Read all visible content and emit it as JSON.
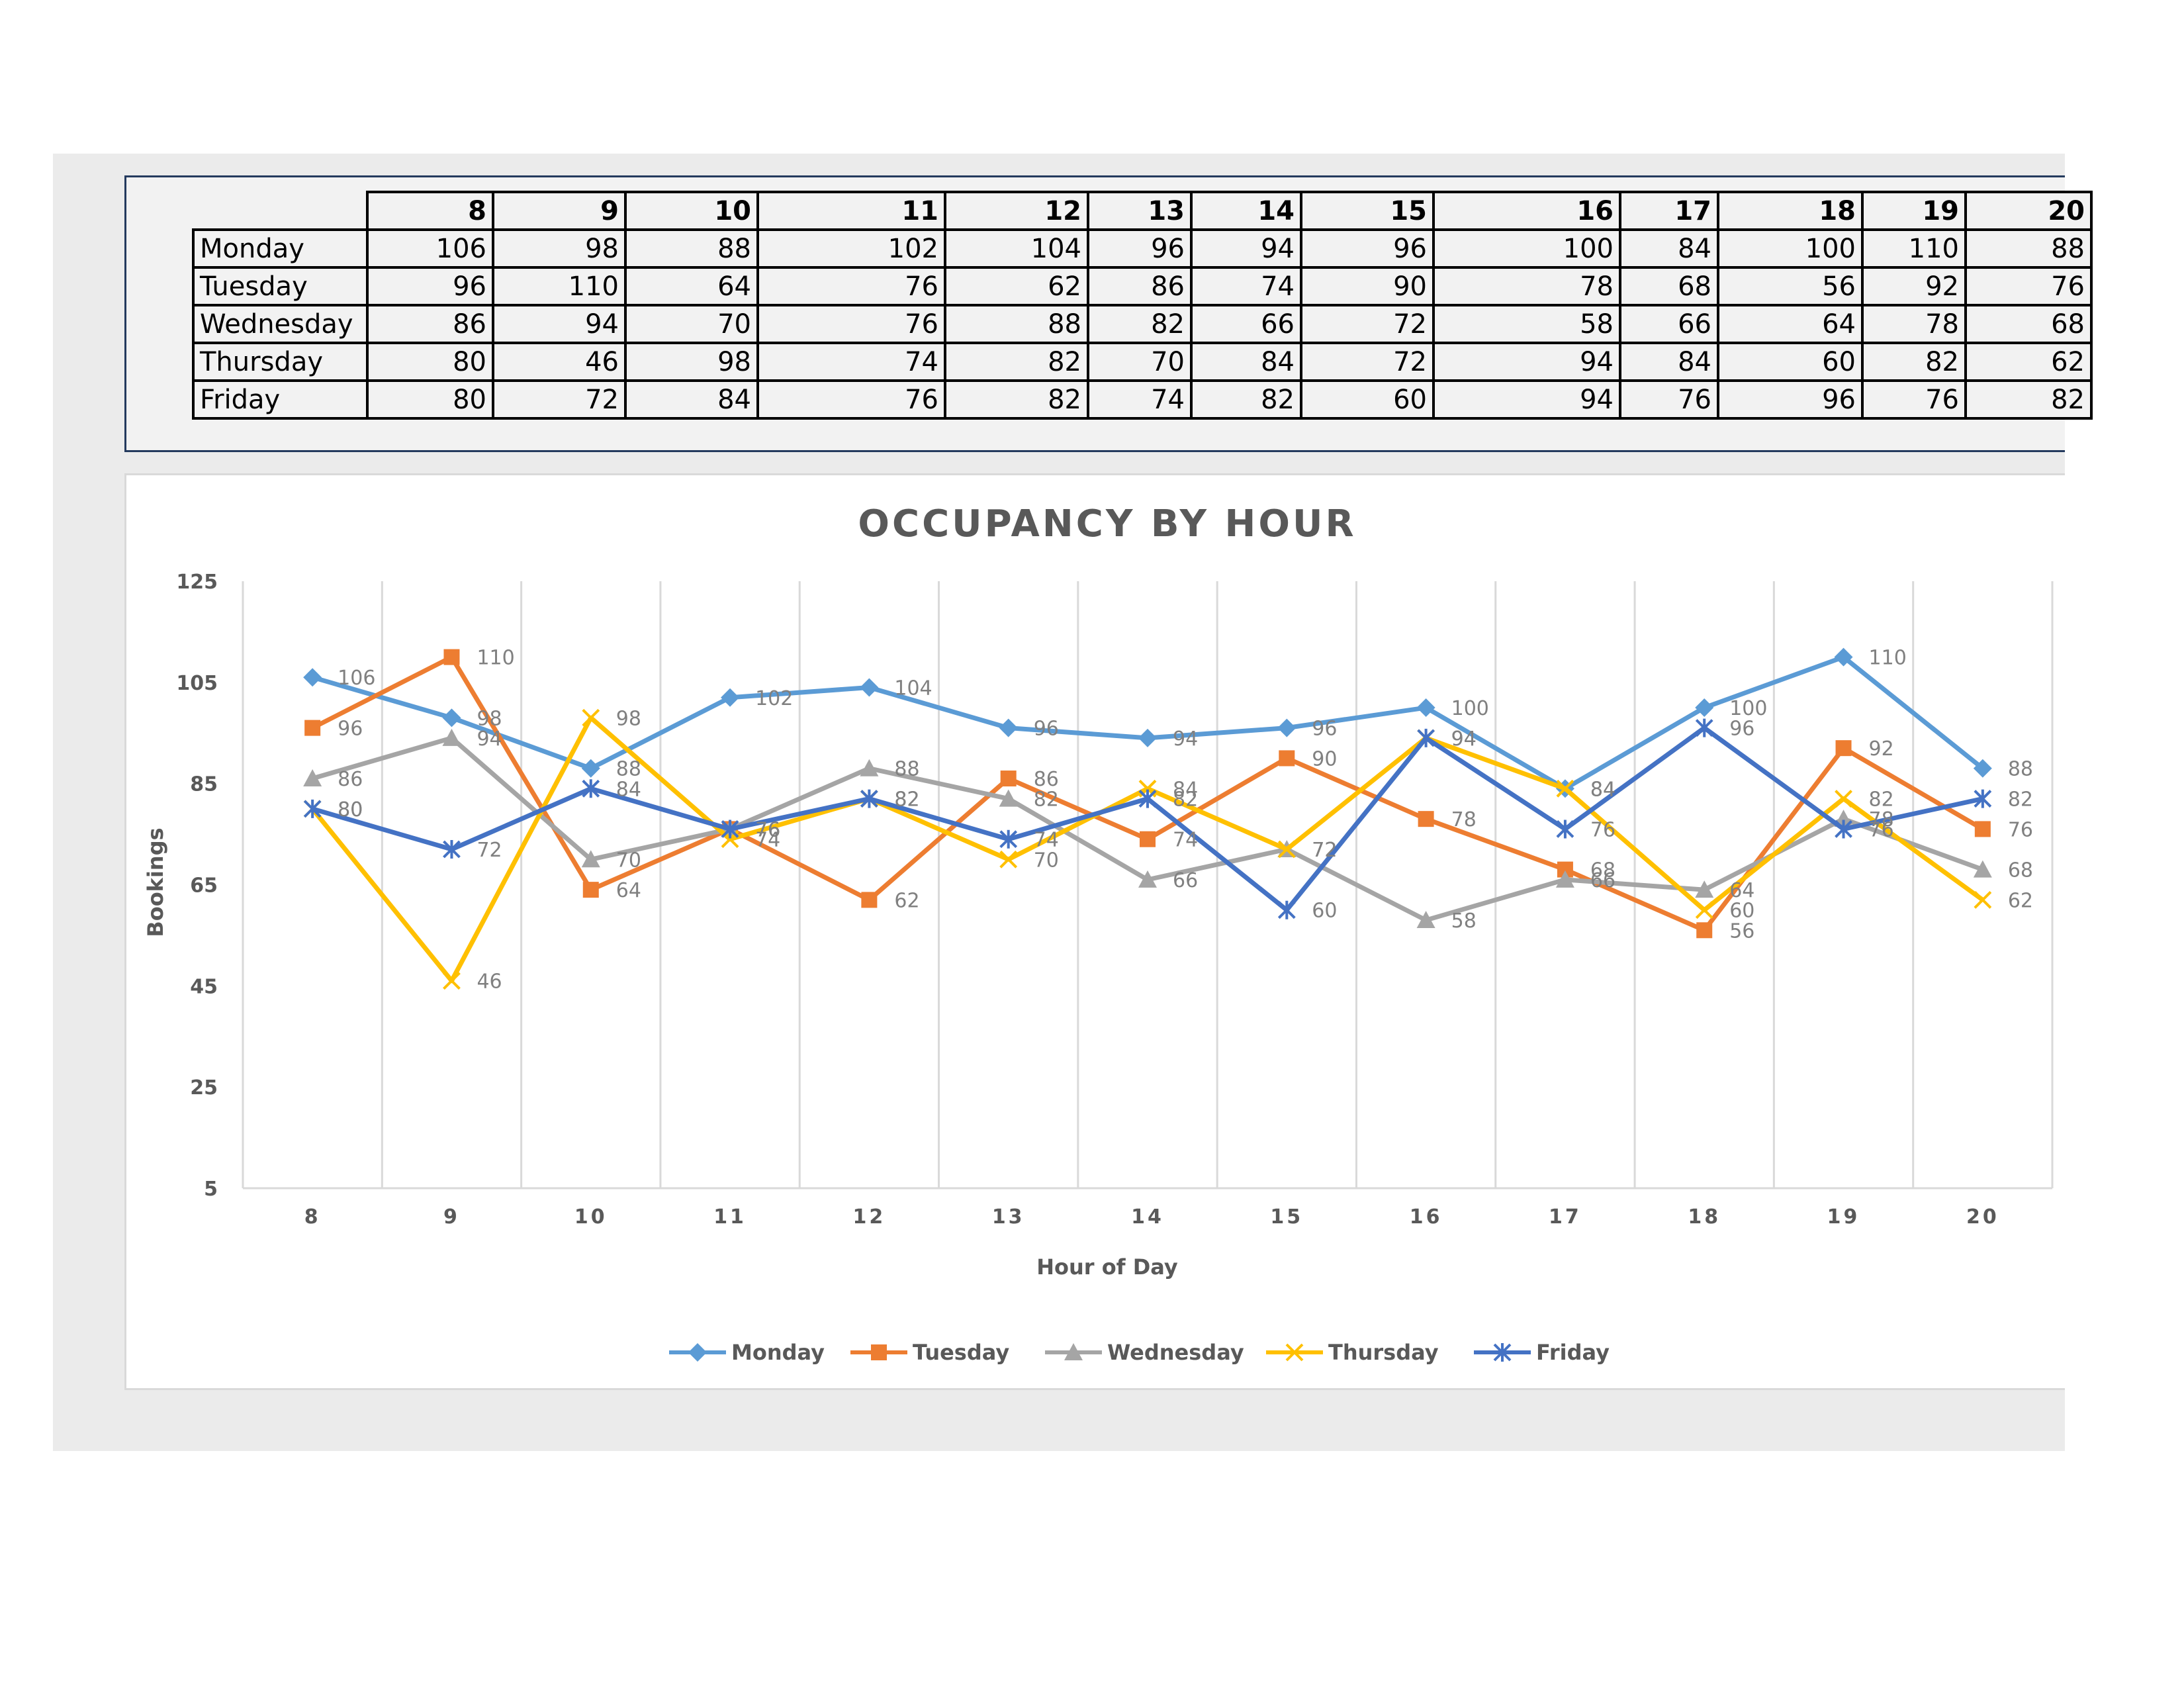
{
  "table": {
    "hours": [
      "8",
      "9",
      "10",
      "11",
      "12",
      "13",
      "14",
      "15",
      "16",
      "17",
      "18",
      "19",
      "20"
    ],
    "rows": [
      {
        "day": "Monday",
        "values": [
          "106",
          "98",
          "88",
          "102",
          "104",
          "96",
          "94",
          "96",
          "100",
          "84",
          "100",
          "110",
          "88"
        ]
      },
      {
        "day": "Tuesday",
        "values": [
          "96",
          "110",
          "64",
          "76",
          "62",
          "86",
          "74",
          "90",
          "78",
          "68",
          "56",
          "92",
          "76"
        ]
      },
      {
        "day": "Wednesday",
        "values": [
          "86",
          "94",
          "70",
          "76",
          "88",
          "82",
          "66",
          "72",
          "58",
          "66",
          "64",
          "78",
          "68"
        ]
      },
      {
        "day": "Thursday",
        "values": [
          "80",
          "46",
          "98",
          "74",
          "82",
          "70",
          "84",
          "72",
          "94",
          "84",
          "60",
          "82",
          "62"
        ]
      },
      {
        "day": "Friday",
        "values": [
          "80",
          "72",
          "84",
          "76",
          "82",
          "74",
          "82",
          "60",
          "94",
          "76",
          "96",
          "76",
          "82"
        ]
      }
    ]
  },
  "chart_data": {
    "type": "line",
    "title": "OCCUPANCY BY HOUR",
    "xlabel": "Hour of Day",
    "ylabel": "Bookings",
    "categories": [
      "8",
      "9",
      "10",
      "11",
      "12",
      "13",
      "14",
      "15",
      "16",
      "17",
      "18",
      "19",
      "20"
    ],
    "ylim": [
      5,
      125
    ],
    "yticks": [
      "125",
      "105",
      "85",
      "65",
      "45",
      "25",
      "5"
    ],
    "grid": "vertical",
    "legend_position": "bottom",
    "series": [
      {
        "name": "Monday",
        "color": "#5b9bd5",
        "marker": "diamond",
        "values": [
          106,
          98,
          88,
          102,
          104,
          96,
          94,
          96,
          100,
          84,
          100,
          110,
          88
        ]
      },
      {
        "name": "Tuesday",
        "color": "#ed7d31",
        "marker": "square",
        "values": [
          96,
          110,
          64,
          76,
          62,
          86,
          74,
          90,
          78,
          68,
          56,
          92,
          76
        ]
      },
      {
        "name": "Wednesday",
        "color": "#a5a5a5",
        "marker": "triangle",
        "values": [
          86,
          94,
          70,
          76,
          88,
          82,
          66,
          72,
          58,
          66,
          64,
          78,
          68
        ]
      },
      {
        "name": "Thursday",
        "color": "#ffc000",
        "marker": "x",
        "values": [
          80,
          46,
          98,
          74,
          82,
          70,
          84,
          72,
          94,
          84,
          60,
          82,
          62
        ]
      },
      {
        "name": "Friday",
        "color": "#4472c4",
        "marker": "star",
        "values": [
          80,
          72,
          84,
          76,
          82,
          74,
          82,
          60,
          94,
          76,
          96,
          76,
          82
        ]
      }
    ]
  }
}
